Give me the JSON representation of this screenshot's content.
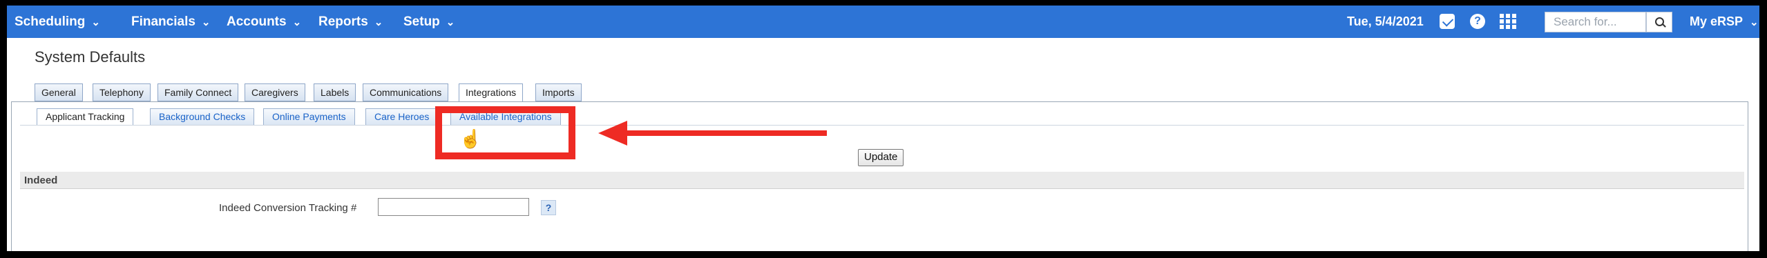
{
  "nav": {
    "items": [
      "Scheduling",
      "Financials",
      "Accounts",
      "Reports",
      "Setup"
    ],
    "chevron": "⌄",
    "date": "Tue, 5/4/2021",
    "search_placeholder": "Search for...",
    "account_label": "My eRSP"
  },
  "page": {
    "title": "System Defaults"
  },
  "tabs": [
    "General",
    "Telephony",
    "Family Connect",
    "Caregivers",
    "Labels",
    "Communications",
    "Integrations",
    "Imports"
  ],
  "active_tab": "Integrations",
  "subtabs": [
    "Applicant Tracking",
    "Background Checks",
    "Online Payments",
    "Care Heroes",
    "Available Integrations"
  ],
  "active_subtab": "Applicant Tracking",
  "update_label": "Update",
  "section": {
    "title": "Indeed",
    "field_label": "Indeed Conversion Tracking #",
    "field_value": "",
    "help_label": "?"
  },
  "annotation": {
    "color": "#ee2b24",
    "highlighted_item": "Available Integrations"
  },
  "colors": {
    "topbar": "#2d74d6",
    "link": "#1a63c8"
  },
  "icons": {
    "mail": "mail-icon",
    "help": "help-icon",
    "grid": "apps-grid-icon",
    "search": "search-icon",
    "cursor": "hand-pointer-icon"
  }
}
